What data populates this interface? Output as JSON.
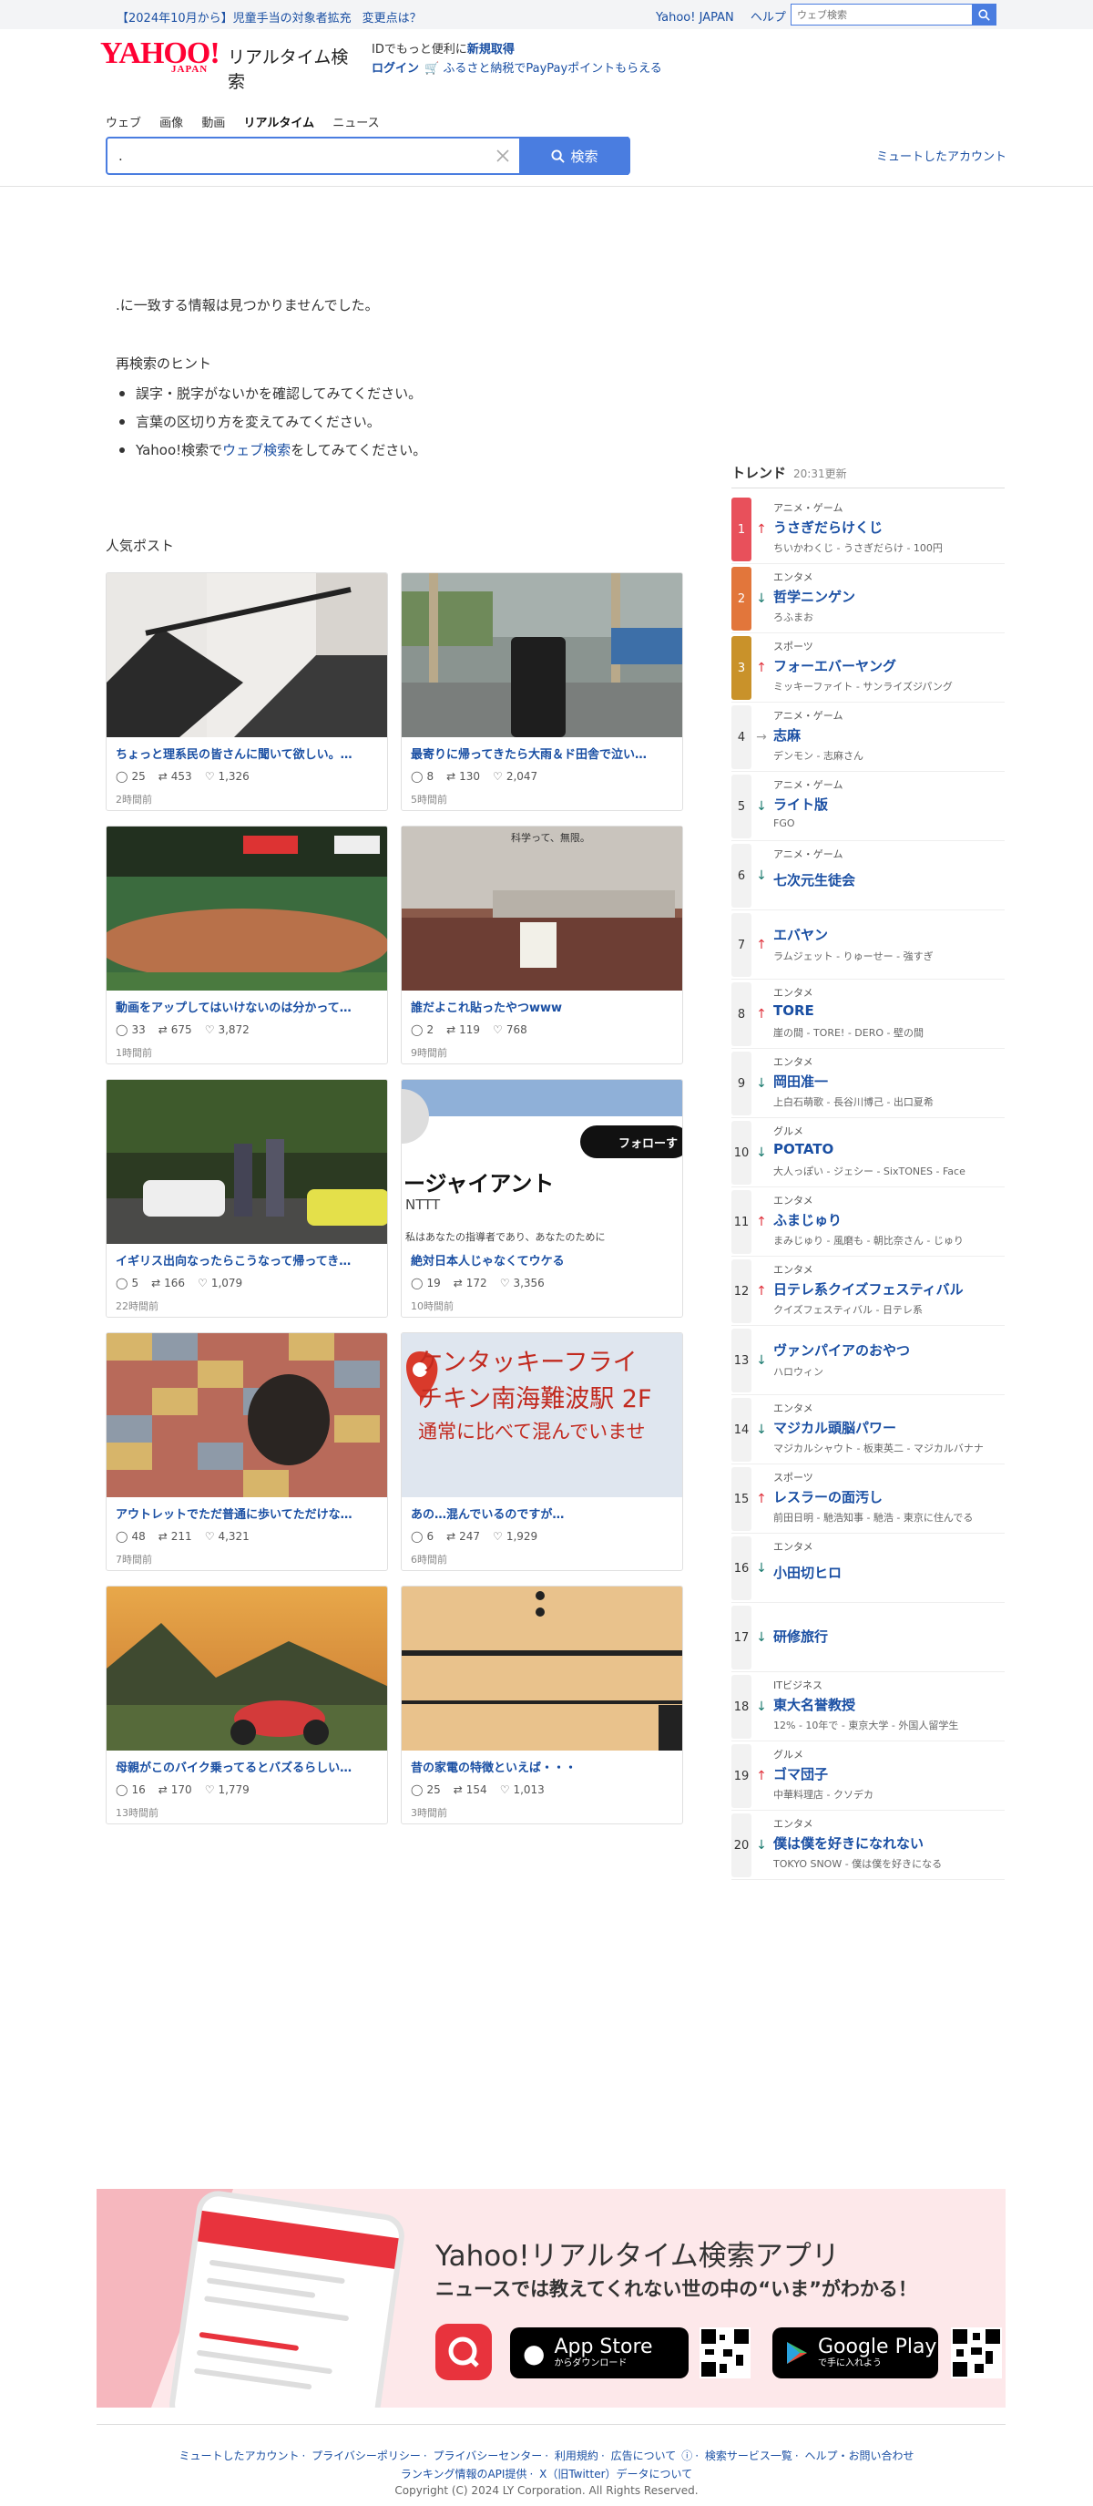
{
  "topbar": {
    "notice": "【2024年10月から】児童手当の対象者拡充",
    "notice_link": "変更点は？",
    "yahoo_japan": "Yahoo! JAPAN",
    "help": "ヘルプ",
    "search_placeholder": "ウェブ検索"
  },
  "logo": {
    "yahoo": "YAHOO!",
    "japan": "JAPAN",
    "service": "リアルタイム検索"
  },
  "idbox": {
    "line1_prefix": "IDでもっと便利に",
    "register": "新規取得",
    "login": "ログイン",
    "furusato": "ふるさと納税でPayPayポイントもらえる"
  },
  "tabs": [
    "ウェブ",
    "画像",
    "動画",
    "リアルタイム",
    "ニュース"
  ],
  "active_tab": "リアルタイム",
  "search": {
    "value": ".",
    "button": "検索"
  },
  "muted_accounts": "ミュートしたアカウント",
  "no_result": ".に一致する情報は見つかりませんでした。",
  "hints": {
    "title": "再検索のヒント",
    "items": [
      "誤字・脱字がないかを確認してみてください。",
      "言葉の区切り方を変えてみてください。"
    ],
    "web_prefix": "Yahoo!検索で",
    "web_link": "ウェブ検索",
    "web_suffix": "をしてみてください。"
  },
  "popular": {
    "title": "人気ポスト",
    "posts": [
      {
        "title": "ちょっと理系民の皆さんに聞いて欲しい。…",
        "replies": "25",
        "reposts": "453",
        "likes": "1,326",
        "ago": "2時間前"
      },
      {
        "title": "最寄りに帰ってきたら大雨＆ド田舎で泣い…",
        "replies": "8",
        "reposts": "130",
        "likes": "2,047",
        "ago": "5時間前"
      },
      {
        "title": "動画をアップしてはいけないのは分かって…",
        "replies": "33",
        "reposts": "675",
        "likes": "3,872",
        "ago": "1時間前"
      },
      {
        "title": "誰だよこれ貼ったやつwww",
        "replies": "2",
        "reposts": "119",
        "likes": "768",
        "ago": "9時間前"
      },
      {
        "title": "イギリス出向なったらこうなって帰ってき…",
        "replies": "5",
        "reposts": "166",
        "likes": "1,079",
        "ago": "22時間前"
      },
      {
        "title": "絶対日本人じゃなくてウケる",
        "replies": "19",
        "reposts": "172",
        "likes": "3,356",
        "ago": "10時間前"
      },
      {
        "title": "アウトレットでただ普通に歩いてただけな…",
        "replies": "48",
        "reposts": "211",
        "likes": "4,321",
        "ago": "7時間前"
      },
      {
        "title": "あの…混んでいるのですが…",
        "replies": "6",
        "reposts": "247",
        "likes": "1,929",
        "ago": "6時間前"
      },
      {
        "title": "母親がこのバイク乗ってるとバズるらしい…",
        "replies": "16",
        "reposts": "170",
        "likes": "1,779",
        "ago": "13時間前"
      },
      {
        "title": "昔の家電の特徴といえば・・・",
        "replies": "25",
        "reposts": "154",
        "likes": "1,013",
        "ago": "3時間前"
      }
    ],
    "image_texts": {
      "giant": "ージャイアント",
      "nttt": "NTTT",
      "follow": "フォローす",
      "small_caption": "私はあなたの指導者であり、あなたのために",
      "kfc1": "ケンタッキーフライ",
      "kfc2": "チキン南海難波駅 2F",
      "kfc3": "通常に比べて混んでいませ",
      "sign": "科学って、無限。"
    }
  },
  "trend": {
    "title": "トレンド",
    "updated": "20:31更新",
    "items": [
      {
        "rank": "1",
        "dir": "up",
        "cat": "アニメ・ゲーム",
        "word": "うさぎだらけくじ",
        "rel": "ちいかわくじ - うさぎだらけ - 100円"
      },
      {
        "rank": "2",
        "dir": "down",
        "cat": "エンタメ",
        "word": "哲学ニンゲン",
        "rel": "ろふまお"
      },
      {
        "rank": "3",
        "dir": "up",
        "cat": "スポーツ",
        "word": "フォーエバーヤング",
        "rel": "ミッキーファイト - サンライズジパング"
      },
      {
        "rank": "4",
        "dir": "flat",
        "cat": "アニメ・ゲーム",
        "word": "志麻",
        "rel": "デンモン - 志麻さん"
      },
      {
        "rank": "5",
        "dir": "down",
        "cat": "アニメ・ゲーム",
        "word": "ライト版",
        "rel": "FGO"
      },
      {
        "rank": "6",
        "dir": "down",
        "cat": "アニメ・ゲーム",
        "word": "七次元生徒会",
        "rel": ""
      },
      {
        "rank": "7",
        "dir": "up",
        "cat": "",
        "word": "エバヤン",
        "rel": "ラムジェット - りゅーせー - 強すぎ"
      },
      {
        "rank": "8",
        "dir": "up",
        "cat": "エンタメ",
        "word": "TORE",
        "rel": "崖の間 - TORE! - DERO - 壁の間"
      },
      {
        "rank": "9",
        "dir": "down",
        "cat": "エンタメ",
        "word": "岡田准一",
        "rel": "上白石萌歌 - 長谷川博己 - 出口夏希"
      },
      {
        "rank": "10",
        "dir": "down",
        "cat": "グルメ",
        "word": "POTATO",
        "rel": "大人っぽい - ジェシー - SixTONES - Face"
      },
      {
        "rank": "11",
        "dir": "up",
        "cat": "エンタメ",
        "word": "ふまじゅり",
        "rel": "まみじゅり - 風磨も - 朝比奈さん - じゅり"
      },
      {
        "rank": "12",
        "dir": "up",
        "cat": "エンタメ",
        "word": "日テレ系クイズフェスティバル",
        "rel": "クイズフェスティバル - 日テレ系"
      },
      {
        "rank": "13",
        "dir": "down",
        "cat": "",
        "word": "ヴァンパイアのおやつ",
        "rel": "ハロウィン"
      },
      {
        "rank": "14",
        "dir": "down",
        "cat": "エンタメ",
        "word": "マジカル頭脳パワー",
        "rel": "マジカルシャウト - 板東英二 - マジカルバナナ"
      },
      {
        "rank": "15",
        "dir": "up",
        "cat": "スポーツ",
        "word": "レスラーの面汚し",
        "rel": "前田日明 - 馳浩知事 - 馳浩 - 東京に住んでる"
      },
      {
        "rank": "16",
        "dir": "down",
        "cat": "エンタメ",
        "word": "小田切ヒロ",
        "rel": ""
      },
      {
        "rank": "17",
        "dir": "down",
        "cat": "",
        "word": "研修旅行",
        "rel": ""
      },
      {
        "rank": "18",
        "dir": "down",
        "cat": "ITビジネス",
        "word": "東大名誉教授",
        "rel": "12% - 10年で - 東京大学 - 外国人留学生"
      },
      {
        "rank": "19",
        "dir": "up",
        "cat": "グルメ",
        "word": "ゴマ団子",
        "rel": "中華料理店 - クソデカ"
      },
      {
        "rank": "20",
        "dir": "down",
        "cat": "エンタメ",
        "word": "僕は僕を好きになれない",
        "rel": "TOKYO SNOW - 僕は僕を好きになる"
      }
    ]
  },
  "banner": {
    "title": "Yahoo!リアルタイム検索アプリ",
    "subtitle": "ニュースでは教えてくれない世の中の“いま”がわかる！",
    "appstore_big": "App Store",
    "appstore_small": "からダウンロード",
    "gplay_big": "Google Play",
    "gplay_small": "で手に入れよう",
    "accent": "#e8333d"
  },
  "footer": {
    "row1": [
      "ミュートしたアカウント",
      "プライバシーポリシー",
      "プライバシーセンター",
      "利用規約",
      "広告について",
      "検索サービス一覧",
      "ヘルプ・お問い合わせ"
    ],
    "row2": [
      "ランキング情報のAPI提供",
      "X（旧Twitter）データについて"
    ],
    "copyright": "Copyright (C) 2024 LY Corporation. All Rights Reserved."
  },
  "colors": {
    "link": "#1a4fa3",
    "accent": "#4a7de0",
    "up": "#e0333d",
    "down": "#1a7a6e"
  }
}
